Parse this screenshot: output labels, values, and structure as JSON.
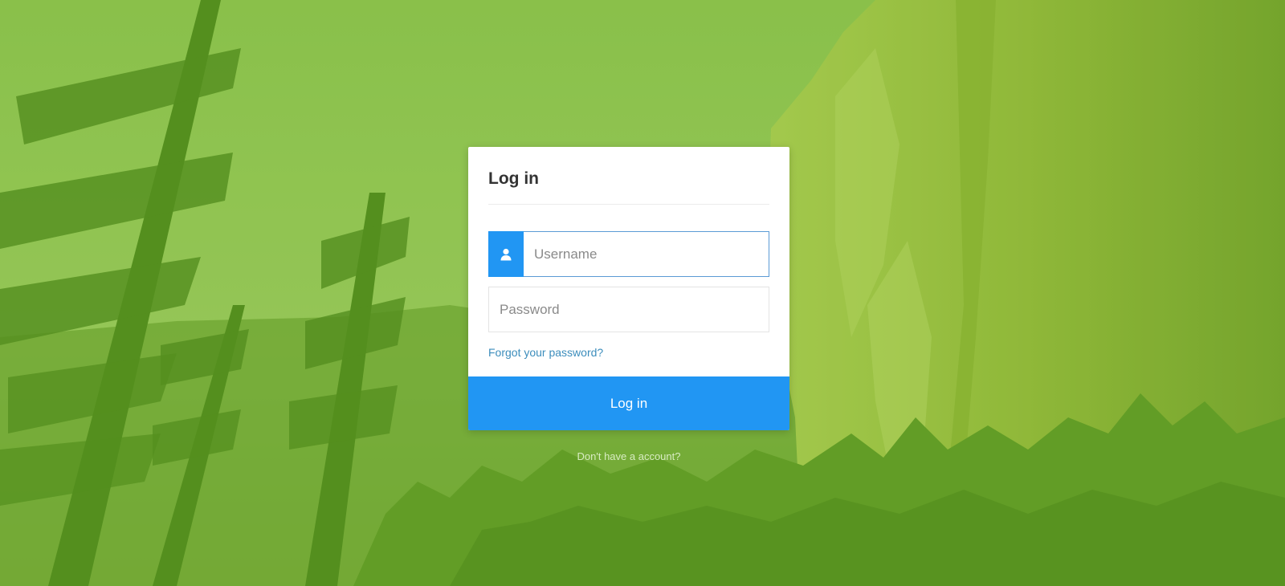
{
  "login": {
    "title": "Log in",
    "username_placeholder": "Username",
    "password_placeholder": "Password",
    "forgot_link": "Forgot your password?",
    "submit_label": "Log in",
    "signup_link": "Don't have a account?"
  },
  "icons": {
    "username_addon": "user-icon"
  },
  "colors": {
    "accent": "#2196f3",
    "link": "#3c8dbc",
    "background_tint": "#7db340"
  }
}
